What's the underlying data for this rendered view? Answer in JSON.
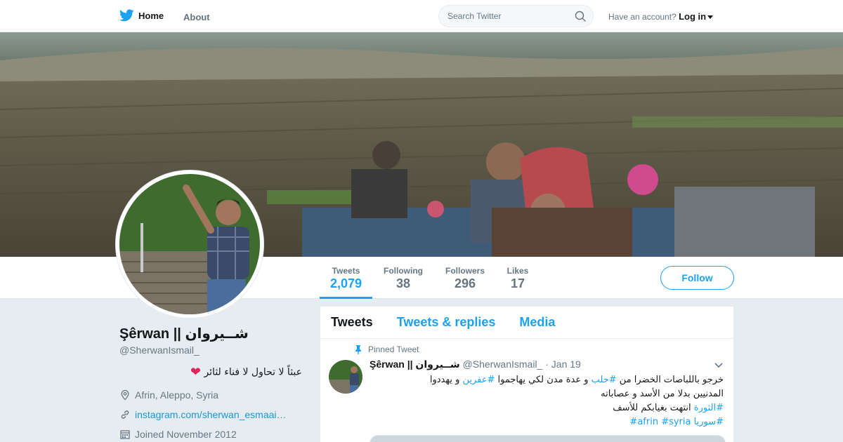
{
  "nav": {
    "home_label": "Home",
    "about_label": "About",
    "search_placeholder": "Search Twitter",
    "account_prompt": "Have an account?",
    "login_label": "Log in"
  },
  "profile_nav": {
    "stats": [
      {
        "label": "Tweets",
        "value": "2,079",
        "active": true
      },
      {
        "label": "Following",
        "value": "38"
      },
      {
        "label": "Followers",
        "value": "296"
      },
      {
        "label": "Likes",
        "value": "17"
      }
    ],
    "follow_label": "Follow"
  },
  "profile": {
    "name": "Şêrwan || شــيروان",
    "handle": "@SherwanIsmail_",
    "bio": "عبثاً لا تحاول لا فناء لثائر",
    "bio_emoji": "heart",
    "location": "Afrin, Aleppo, Syria",
    "website": "instagram.com/sherwan_esmaai…",
    "joined": "Joined November 2012"
  },
  "timeline": {
    "tabs": [
      "Tweets",
      "Tweets & replies",
      "Media"
    ],
    "active_tab": 0,
    "tweet": {
      "pinned_label": "Pinned Tweet",
      "author_name": "Şêrwan || شــيروان",
      "author_handle": "@SherwanIsmail_",
      "date": "· Jan 19",
      "line1_text": "خرجو باللباصات الخضرا من ",
      "line1_tag": "#حلب",
      "line1_rest": " و عدة مدن لكي يهاجموا ",
      "line1_tag2": "#عفرين",
      "line1_end": " و يهددوا",
      "line2": "المدنيين بدلا من الأسد و عصاباته",
      "line3_tag": "#الثورة",
      "line3_rest": " انتهت بغيابكم للأسف",
      "tag_afrin": "#afrin",
      "tag_syria": "#syria",
      "tag_syria_ar": "#سوريا"
    }
  },
  "colors": {
    "accent": "#1da1f2",
    "text": "#14171a",
    "muted": "#657786",
    "background": "#e6ecf0"
  },
  "icons": [
    "twitter-bird-icon",
    "search-icon",
    "location-pin-icon",
    "link-icon",
    "calendar-icon",
    "pin-icon",
    "chevron-down-icon",
    "heart-icon"
  ]
}
